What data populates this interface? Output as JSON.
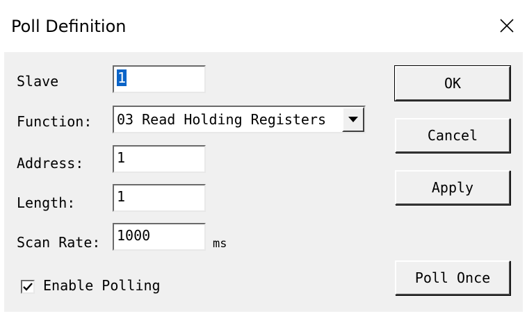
{
  "window": {
    "title": "Poll Definition",
    "close_icon": "close-icon"
  },
  "form": {
    "slave": {
      "label": "Slave",
      "value": "1"
    },
    "function": {
      "label": "Function:",
      "value": "03 Read Holding Registers"
    },
    "address": {
      "label": "Address:",
      "value": "1"
    },
    "length": {
      "label": "Length:",
      "value": "1"
    },
    "scan_rate": {
      "label": "Scan Rate:",
      "value": "1000",
      "unit": "ms"
    },
    "enable_polling": {
      "label": "Enable Polling",
      "checked": true
    }
  },
  "buttons": {
    "ok": "OK",
    "cancel": "Cancel",
    "apply": "Apply",
    "poll_once": "Poll Once"
  },
  "colors": {
    "selection": "#0a64c8",
    "dialog_face": "#f0f0f0"
  }
}
